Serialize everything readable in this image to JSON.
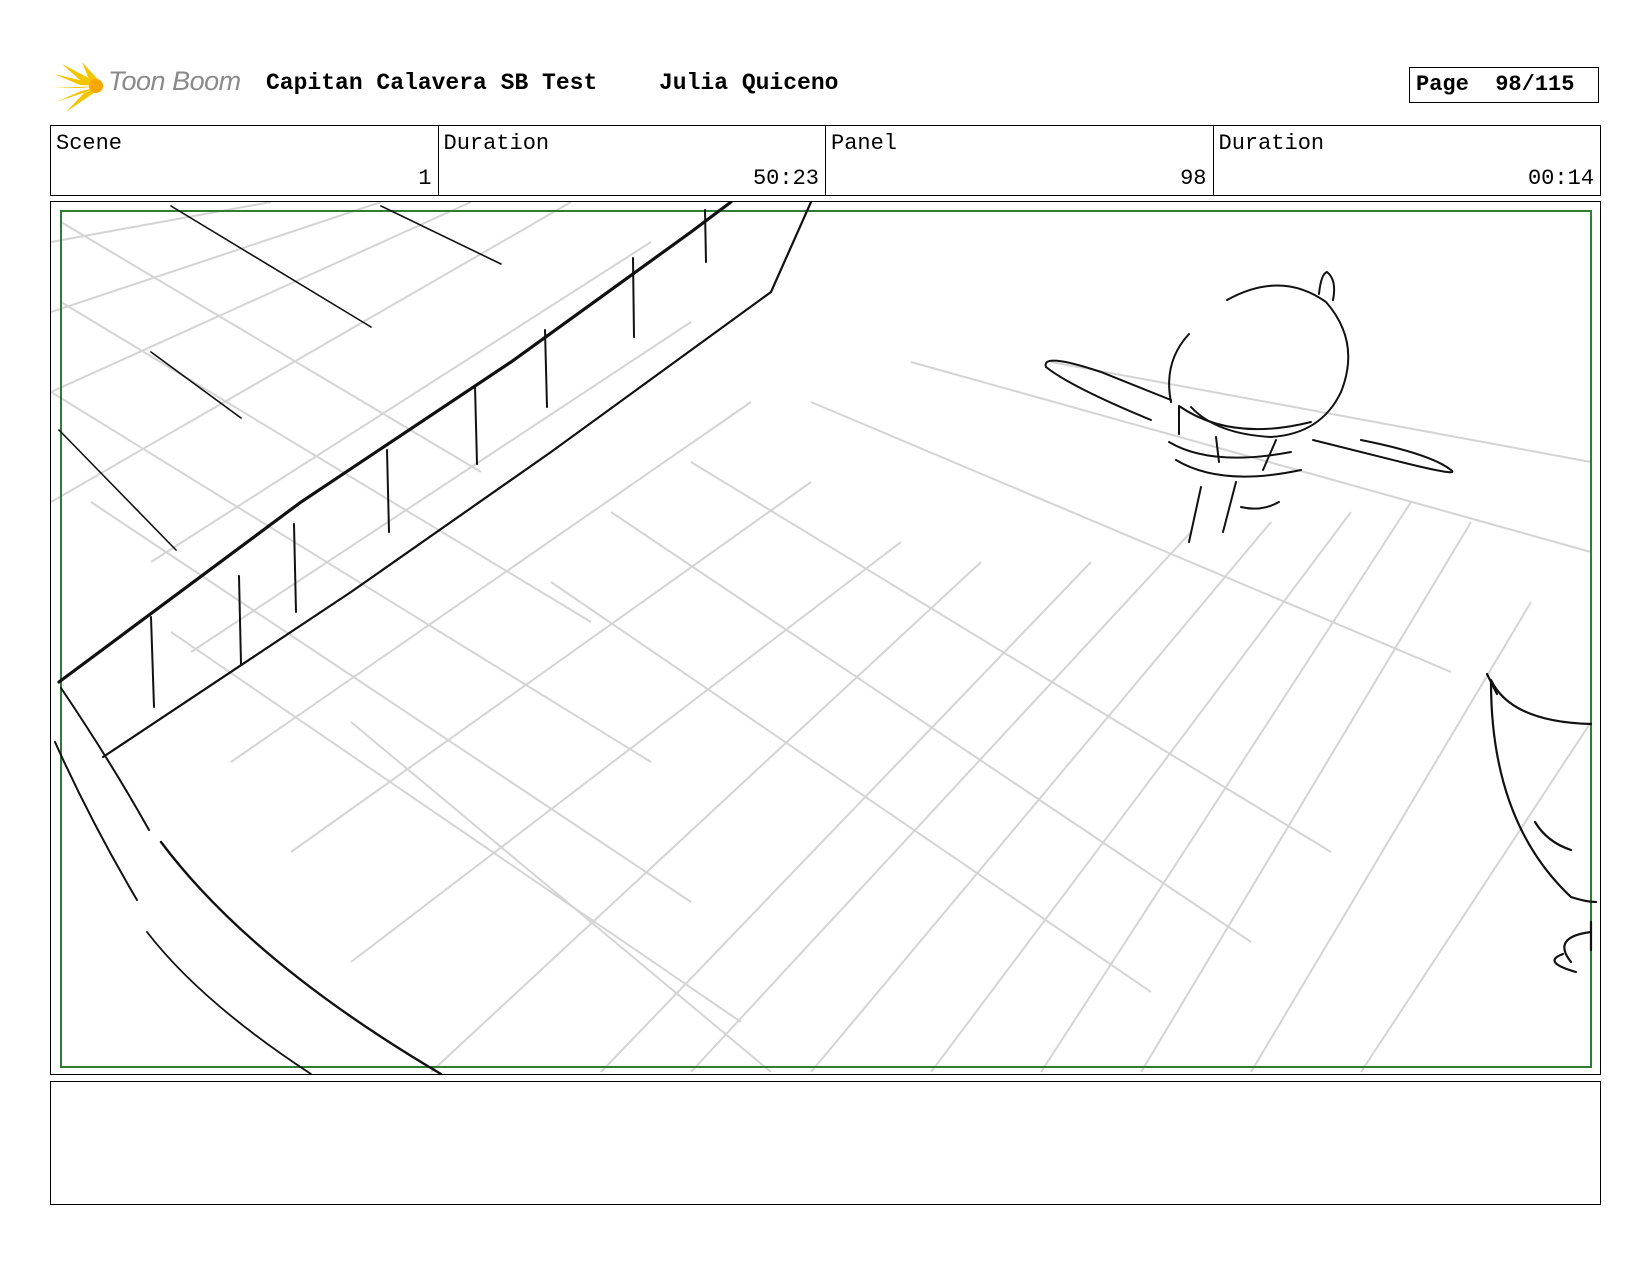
{
  "header": {
    "logo_text": "Toon Boom",
    "project_title": "Capitan Calavera SB Test",
    "author": "Julia Quiceno",
    "page_label": "Page",
    "page_value": "98/115"
  },
  "info": {
    "scene_label": "Scene",
    "scene_value": "1",
    "scene_duration_label": "Duration",
    "scene_duration_value": "50:23",
    "panel_label": "Panel",
    "panel_value": "98",
    "panel_duration_label": "Duration",
    "panel_duration_value": "00:14"
  },
  "notes": {
    "text": ""
  },
  "colors": {
    "frame_green": "#2e7d32",
    "sketch_black": "#111111",
    "grid_grey": "#d0d0d0",
    "logo_yellow": "#f5c400",
    "logo_grey": "#8a8a8a"
  }
}
